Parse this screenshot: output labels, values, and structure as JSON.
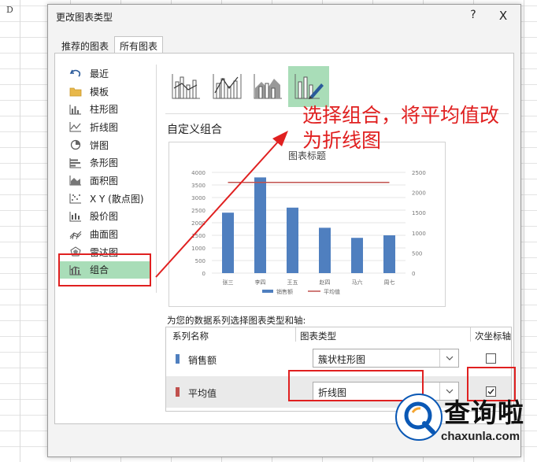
{
  "sheet": {
    "col_label": "D"
  },
  "dialog": {
    "title": "更改图表类型",
    "help": "?",
    "close": "X",
    "tabs": [
      "推荐的图表",
      "所有图表"
    ],
    "chart_types": [
      "最近",
      "模板",
      "柱形图",
      "折线图",
      "饼图",
      "条形图",
      "面积图",
      "X Y (散点图)",
      "股价图",
      "曲面图",
      "雷达图",
      "组合"
    ],
    "selected_type": "组合",
    "custom_combo_label": "自定义组合",
    "series_instruction": "为您的数据系列选择图表类型和轴:",
    "table_headers": {
      "name": "系列名称",
      "type": "图表类型",
      "secondary": "次坐标轴"
    },
    "series": [
      {
        "name": "销售额",
        "chart_type": "簇状柱形图",
        "secondary_axis": false,
        "color": "#4f7fbf"
      },
      {
        "name": "平均值",
        "chart_type": "折线图",
        "secondary_axis": true,
        "color": "#c0504d"
      }
    ]
  },
  "chart_data": {
    "type": "bar",
    "title": "图表标题",
    "categories": [
      "张三",
      "李四",
      "王五",
      "赵四",
      "马六",
      "周七"
    ],
    "series": [
      {
        "name": "销售额",
        "type": "bar",
        "axis": "primary",
        "values": [
          2400,
          3800,
          2600,
          1800,
          1400,
          1500
        ],
        "color": "#4f7fbf"
      },
      {
        "name": "平均值",
        "type": "line",
        "axis": "secondary",
        "values": [
          2250,
          2250,
          2250,
          2250,
          2250,
          2250
        ],
        "color": "#c0504d"
      }
    ],
    "ylim": [
      0,
      4000
    ],
    "y_ticks": [
      0,
      500,
      1000,
      1500,
      2000,
      2500,
      3000,
      3500,
      4000
    ],
    "y2lim": [
      0,
      2500
    ],
    "y2_ticks": [
      0,
      500,
      1000,
      1500,
      2000,
      2500
    ],
    "legend_position": "bottom"
  },
  "annotation": {
    "text_line1": "选择组合，将平均值改",
    "text_line2": "为折线图",
    "color": "#e02020"
  },
  "watermark": {
    "text": "查询啦",
    "url": "chaxunla.com"
  }
}
